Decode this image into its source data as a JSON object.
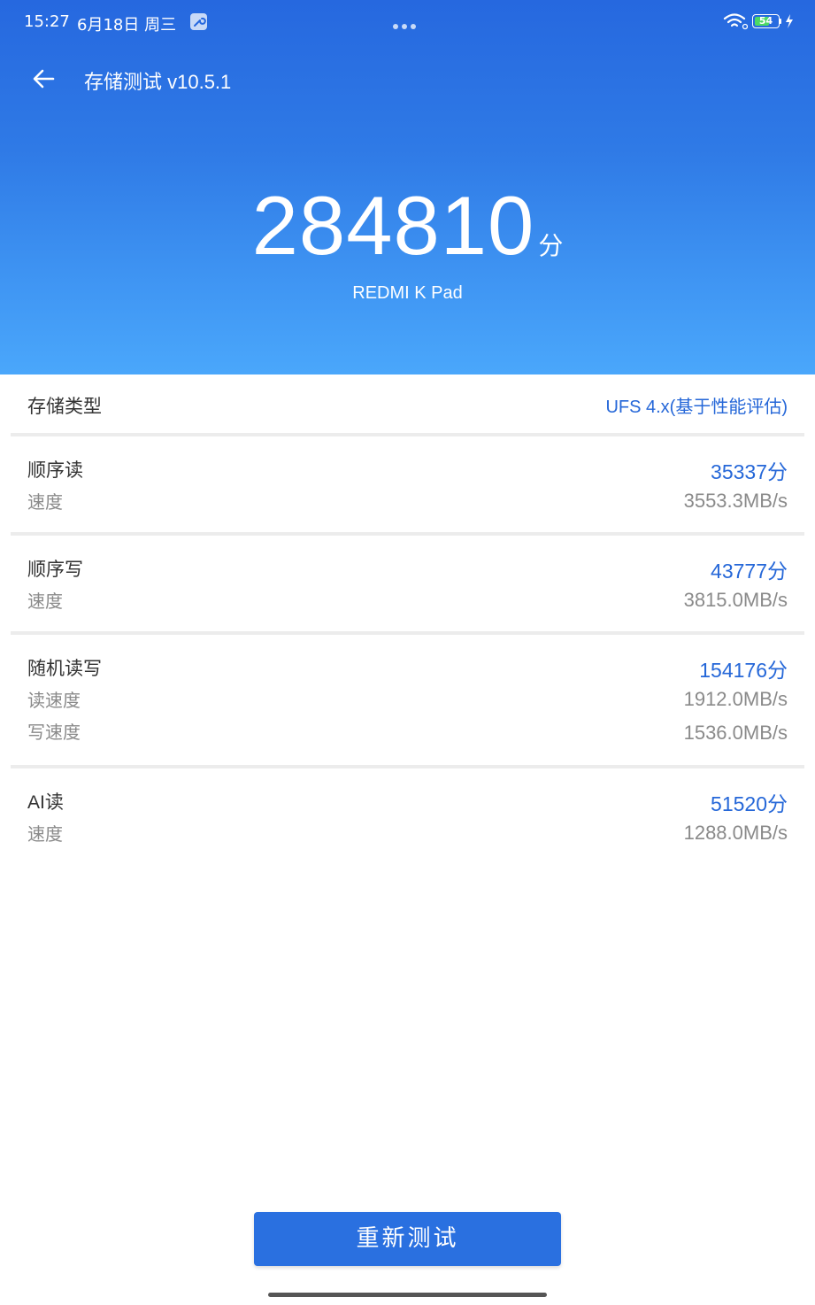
{
  "status_bar": {
    "time": "15:27",
    "date": "6月18日 周三",
    "battery_level": "54"
  },
  "header": {
    "title": "存储测试 v10.5.1"
  },
  "score": {
    "total": "284810",
    "unit": "分",
    "device": "REDMI K Pad"
  },
  "storage_type": {
    "label": "存储类型",
    "value": "UFS 4.x(基于性能评估)"
  },
  "sequential_read": {
    "label": "顺序读",
    "sub_label": "速度",
    "score": "35337分",
    "speed": "3553.3MB/s"
  },
  "sequential_write": {
    "label": "顺序写",
    "sub_label": "速度",
    "score": "43777分",
    "speed": "3815.0MB/s"
  },
  "random_rw": {
    "label": "随机读写",
    "read_label": "读速度",
    "write_label": "写速度",
    "score": "154176分",
    "read_speed": "1912.0MB/s",
    "write_speed": "1536.0MB/s"
  },
  "ai_read": {
    "label": "AI读",
    "sub_label": "速度",
    "score": "51520分",
    "speed": "1288.0MB/s"
  },
  "retest_button": {
    "label": "重新测试"
  },
  "colors": {
    "accent": "#2a70e0",
    "value_blue": "#2567d8",
    "header_top": "#2668df",
    "header_bottom": "#4aa7fb"
  }
}
